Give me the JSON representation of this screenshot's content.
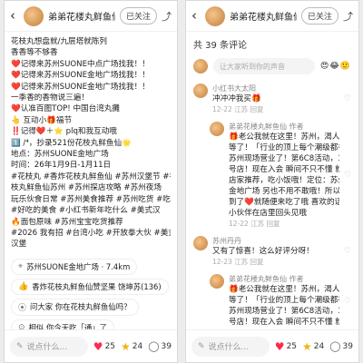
{
  "left": {
    "author": "弟弟花楼丸鲜鱼仙",
    "follow": "已关注",
    "lines": [
      "花枝丸想盘就/九层塔就陈列",
      "香香等不够香",
      "❤️记得来苏州SUONE中点广场找我！！",
      "❤️记得来苏州SUONE金地广场找我！！",
      "❤️记得来苏州SUONE金地广场找我！！",
      "一季香的香物说三遍！",
      "❤️认准百图TOP! 中国台湾丸攤",
      "👆 互动小🎁福节",
      "‼️记得❤️＋⭐ plq和我互动哦",
      "1️⃣ /⁴，抄录521份花枝丸鲜鱼仙🌟",
      "地点：苏州SUONE金地广场",
      "时间：26年1月9日-1月11日",
      "#花枝丸 #香炸花枝丸鲜鱼仙 #苏州汉堡节 #香炸花",
      "枝丸鲜鱼仙苏州 #苏州探店攻略 #苏州夜场",
      "玩乐伙食日常 #苏州美食推荐 #苏州吃货 #吃货",
      "#好吃的美食 #小红书新年吃什么 #美式汉",
      "🔥面包原味 #苏州宝宝吃货推荐",
      "#2026 我有招 #台湾小吃 #开放拳大伙 #美式",
      "汉堡"
    ],
    "location": "苏州SUONE金地广场 · 7.4km",
    "product": "香炸花枝丸鲜鱼仙赞坚果 饶坤苏(136)",
    "qa": "问大家 你在花枝丸鲜鱼仙吗？",
    "pick": "相似 你今天吃「通」了"
  },
  "right": {
    "author": "弟弟花楼丸鲜鱼仙",
    "follow": "已关注",
    "comment_count": "共 39 条评论",
    "input_placeholder": "让大家听到你的声音",
    "input_emoji": "😍😂🙂",
    "comments": [
      {
        "name": "小红书大太阳",
        "lines": [
          "冲冲冲我买🎁"
        ],
        "meta": "12-22 江苏 回复",
        "reply": false
      },
      {
        "name": "弟弟花楼丸鲜鱼仙 作者",
        "lines": [
          "🎁老公我就在这里！苏州，渴人家久",
          "等了！「行业的顶上每个潮级都有」",
          "苏州现场营业了！第6C8活动，12.31",
          "号店！现在入会 瞬间不只不懂 就没收位 苏州SUONE金",
          "店家推荐，吃小饭哦！定位：苏州SUONE",
          "金地广场 另也不用不敢哦！所以你都要再",
          "到了❤️就随便来吃了哦 喜欢的话 就要来来哦",
          "小伙伴在店里回头见哦"
        ],
        "meta": "12-22 江苏 回复",
        "reply": true
      },
      {
        "name": "苏州丹丹",
        "lines": [
          "又有了惊喜！这么好评分呀！"
        ],
        "meta": "12-23 江苏 回复",
        "reply": false
      },
      {
        "name": "弟弟花楼丸鲜鱼仙 作者",
        "lines": [
          "🎁老公我就在这里！苏州，渴人家久",
          "等了！「行业的顶上每个潮级都有」",
          "苏州现场营业了！第6C8活动，12.31",
          "号店！现在入会 瞬间不只不懂 就没收位"
        ],
        "meta": "",
        "reply": true
      }
    ]
  },
  "bottom": {
    "say_placeholder": "说点什么...",
    "likes": "25",
    "stars": "24",
    "comments": "39"
  }
}
